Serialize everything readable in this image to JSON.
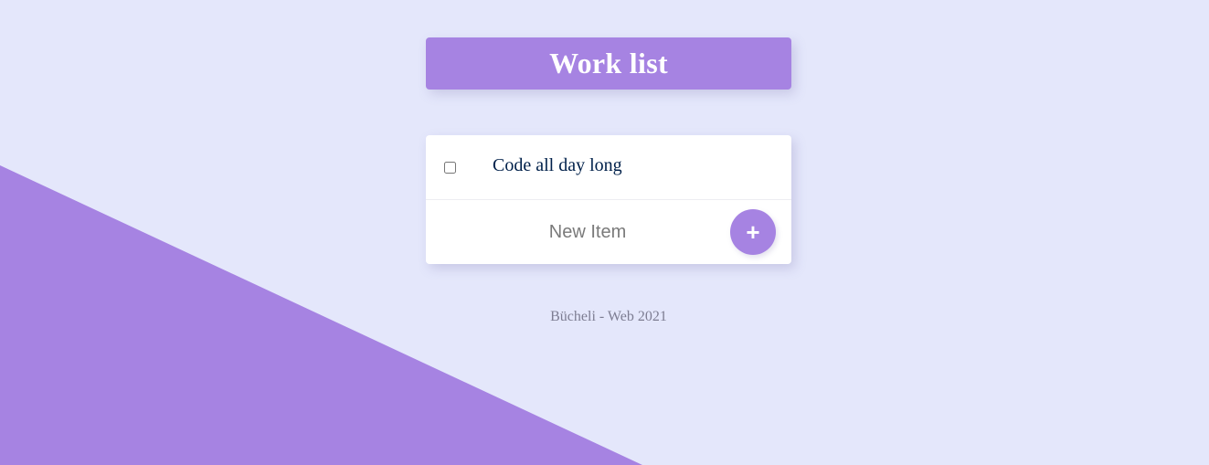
{
  "theme": {
    "background": "#E4E7FB",
    "accent": "#A683E2",
    "item_text_color": "#00204A",
    "footer_color": "#7D7D92"
  },
  "header": {
    "title": "Work list"
  },
  "list": {
    "items": [
      {
        "label": "Code all day long",
        "checked": false
      }
    ]
  },
  "new_item": {
    "placeholder": "New Item",
    "value": "",
    "add_button_label": "+"
  },
  "footer": {
    "text": "Bücheli - Web 2021"
  }
}
